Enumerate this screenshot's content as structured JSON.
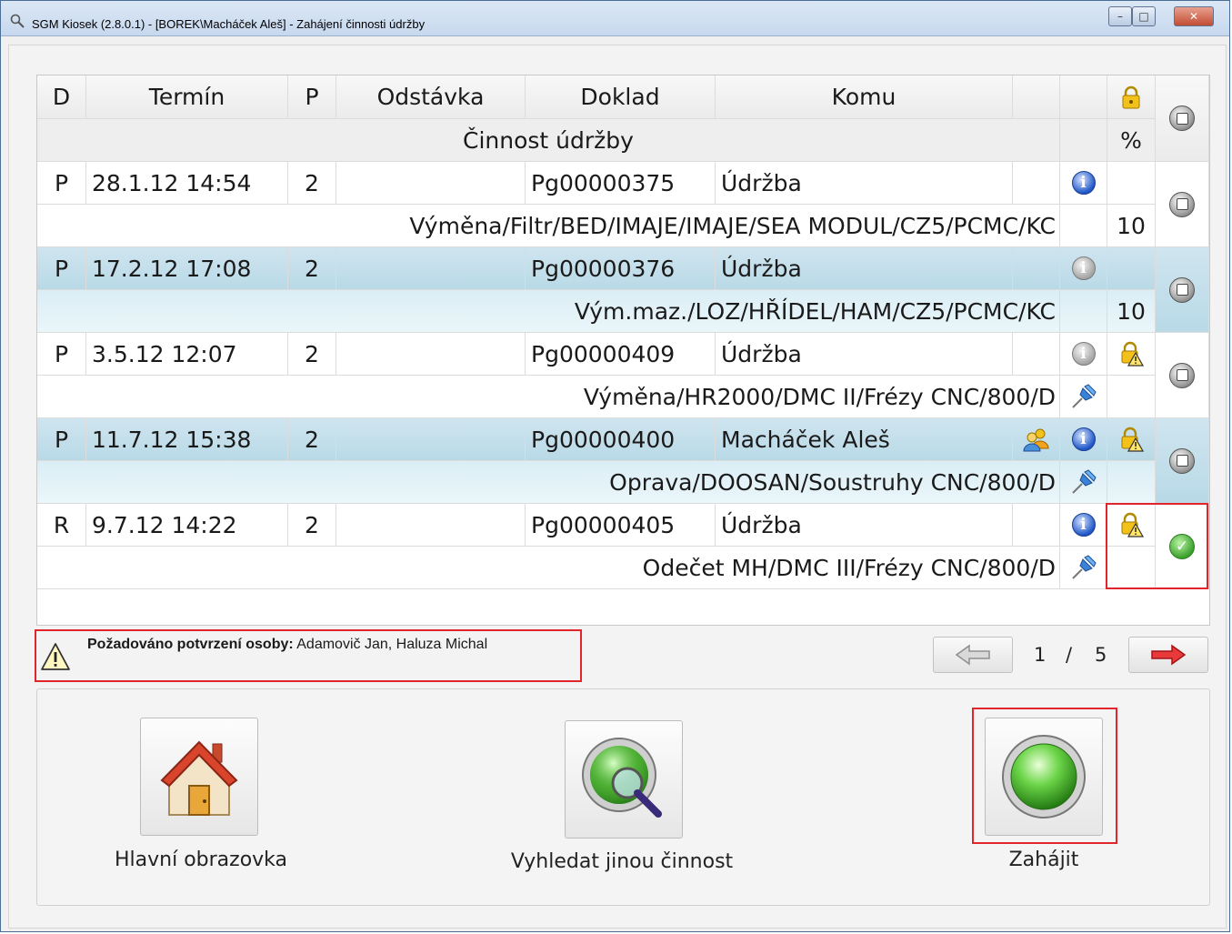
{
  "window": {
    "title": "SGM Kiosek (2.8.0.1) - [BOREK\\Macháček Aleš] - Zahájení činnosti údržby",
    "controls": {
      "minimize": "–",
      "maximize": "□",
      "close": "✕"
    }
  },
  "grid": {
    "headers": {
      "d": "D",
      "termin": "Termín",
      "p": "P",
      "odstavka": "Odstávka",
      "doklad": "Doklad",
      "komu": "Komu",
      "percent": "%"
    },
    "subheader": "Činnost údržby",
    "rows": [
      {
        "d": "P",
        "termin": "28.1.12 14:54",
        "p": "2",
        "odstavka": "",
        "doklad": "Pg00000375",
        "komu": "Údržba",
        "description": "Výměna/Filtr/BED/IMAJE/IMAJE/SEA MODUL/CZ5/PCMC/KC",
        "percent": "10",
        "info": "info-icon",
        "status": "stop-icon"
      },
      {
        "d": "P",
        "termin": "17.2.12 17:08",
        "p": "2",
        "odstavka": "",
        "doklad": "Pg00000376",
        "komu": "Údržba",
        "description": "Vým.maz./LOZ/HŘÍDEL/HAM/CZ5/PCMC/KC",
        "percent": "10",
        "info": "info-disabled-icon",
        "status": "stop-icon"
      },
      {
        "d": "P",
        "termin": "3.5.12 12:07",
        "p": "2",
        "odstavka": "",
        "doklad": "Pg00000409",
        "komu": "Údržba",
        "description": "Výměna/HR2000/DMC II/Frézy CNC/800/D",
        "percent": "",
        "info": "info-disabled-icon",
        "status": "stop-icon"
      },
      {
        "d": "P",
        "termin": "11.7.12 15:38",
        "p": "2",
        "odstavka": "",
        "doklad": "Pg00000400",
        "komu": "Macháček Aleš",
        "description": "Oprava/DOOSAN/Soustruhy CNC/800/D",
        "percent": "",
        "info": "info-icon",
        "status": "stop-icon"
      },
      {
        "d": "R",
        "termin": "9.7.12 14:22",
        "p": "2",
        "odstavka": "",
        "doklad": "Pg00000405",
        "komu": "Údržba",
        "description": "Odečet MH/DMC III/Frézy CNC/800/D",
        "percent": "",
        "info": "info-icon",
        "status": "ok-icon"
      }
    ]
  },
  "warning": {
    "label": "Požadováno potvrzení osoby:",
    "value": " Adamovič Jan, Haluza Michal"
  },
  "pager": {
    "current": "1",
    "separator": "/",
    "total": "5"
  },
  "actions": {
    "home": "Hlavní obrazovka",
    "search": "Vyhledat jinou činnost",
    "start": "Zahájit"
  },
  "colors": {
    "highlight_border": "#e0262b",
    "row_blue": "#c4dfeb"
  }
}
